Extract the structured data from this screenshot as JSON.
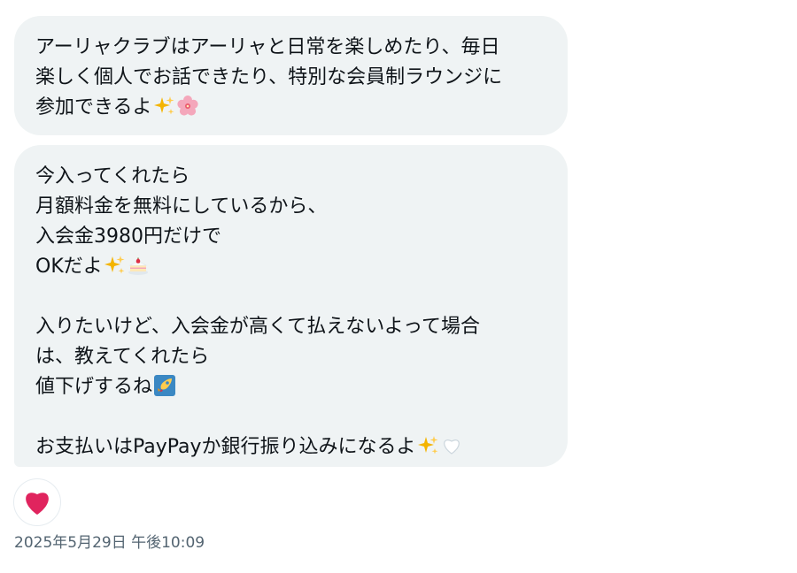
{
  "messages": [
    {
      "lines": [
        "アーリャクラブはアーリャと日常を楽しめたり、毎日",
        "楽しく個人でお話できたり、特別な会員制ラウンジに",
        "参加できるよ"
      ]
    },
    {
      "lines": [
        "今入ってくれたら",
        "月額料金を無料にしているから、",
        "入会金3980円だけで",
        "OKだよ",
        "",
        "入りたいけど、入会金が高くて払えないよって場合",
        "は、教えてくれたら",
        "値下げするね",
        "",
        "お支払いはPayPayか銀行振り込みになるよ"
      ]
    }
  ],
  "emoji_icons": {
    "sparkles": "sparkles-icon",
    "cherry_blossom": "cherry-blossom-icon",
    "cake": "shortcake-icon",
    "rocket": "rocket-icon",
    "white_heart": "white-heart-icon"
  },
  "reaction": {
    "icon": "red-heart-icon",
    "color": "#e0245e"
  },
  "timestamp": "2025年5月29日 午後10:09",
  "colors": {
    "bubble_background": "#eff3f4",
    "text": "#0f1419",
    "timestamp_text": "#536471",
    "sparkles": "#f4b400",
    "cherry_blossom": "#f4a7bb",
    "rocket_tile": "#3b88c3"
  }
}
